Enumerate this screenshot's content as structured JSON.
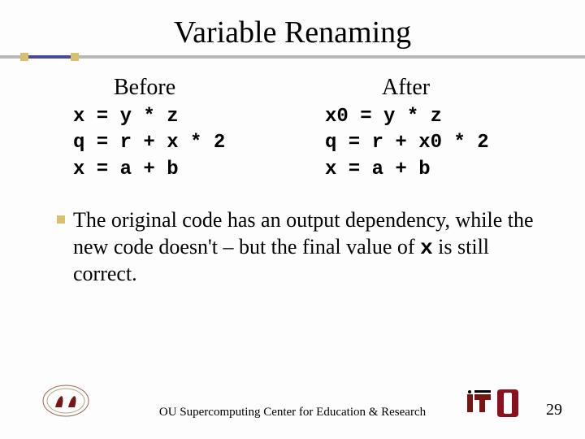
{
  "title": "Variable Renaming",
  "columns": {
    "before": {
      "heading": "Before",
      "code": "x = y * z\nq = r + x * 2\nx = a + b"
    },
    "after": {
      "heading": "After",
      "code": "x0 = y * z\nq = r + x0 * 2\nx = a + b"
    }
  },
  "paragraph": {
    "pre": "The original code has an output dependency, while the new code doesn't – but the final value of ",
    "code": "x",
    "post": " is still correct."
  },
  "footer": {
    "text": "OU Supercomputing Center for Education & Research",
    "page": "29"
  }
}
